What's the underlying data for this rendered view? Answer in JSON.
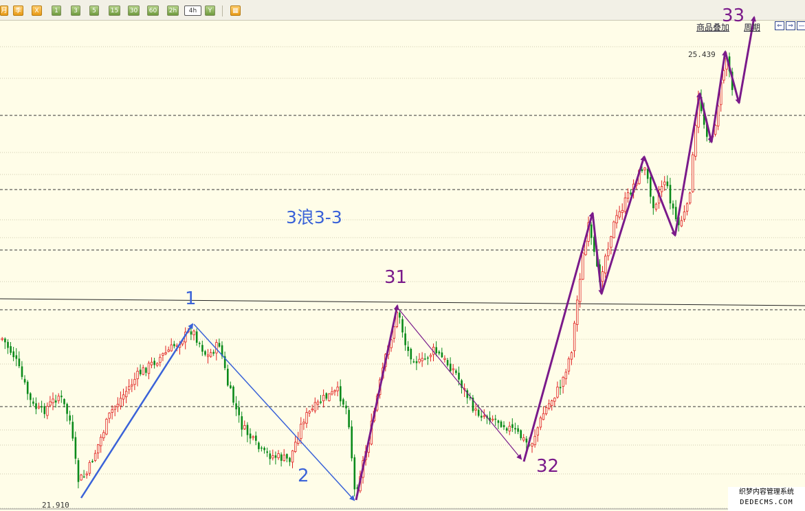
{
  "toolbar": {
    "buttons": [
      {
        "label": "月",
        "style": "orange"
      },
      {
        "label": "季",
        "style": "orange"
      },
      {
        "label": "X",
        "style": "orange"
      },
      {
        "label": "1",
        "style": "period"
      },
      {
        "label": "3",
        "style": "period"
      },
      {
        "label": "5",
        "style": "period"
      },
      {
        "label": "15",
        "style": "period"
      },
      {
        "label": "30",
        "style": "period"
      },
      {
        "label": "60",
        "style": "period"
      },
      {
        "label": "2h",
        "style": "period"
      },
      {
        "label": "4h",
        "style": "active"
      },
      {
        "label": "Y",
        "style": "period"
      }
    ],
    "grid_icon": "grid-icon"
  },
  "header_links": {
    "overlay": "商品叠加",
    "period": "周期"
  },
  "nav_buttons": [
    "left-arrow-icon",
    "right-arrow-icon",
    "minimize-icon"
  ],
  "labels": {
    "title": "3浪3-3",
    "price_high": "25.439",
    "price_low": "21.910"
  },
  "colors": {
    "background": "#fffde8",
    "candle_up": "#e02020",
    "candle_down": "#0a8a1a",
    "blue_wave": "#3a62d8",
    "purple_wave": "#7a1a8a",
    "grid": "#333333"
  },
  "watermark": {
    "line1": "织梦内容管理系统",
    "line2": "DEDECMS.COM"
  },
  "chart_data": {
    "type": "candlestick",
    "title": "3浪3-3",
    "y_range": [
      21.8,
      25.8
    ],
    "price_extremes": {
      "high": 25.439,
      "low": 21.91
    },
    "wave_labels": [
      {
        "text": "1",
        "color": "blue",
        "x": 279,
        "price": 23.08
      },
      {
        "text": "2",
        "color": "blue",
        "x": 520,
        "price": 21.88
      },
      {
        "text": "31",
        "color": "purple",
        "x": 577,
        "price": 23.15
      },
      {
        "text": "32",
        "color": "purple",
        "x": 765,
        "price": 22.29
      },
      {
        "text": "33",
        "color": "purple",
        "x": 1095,
        "price": 25.72
      }
    ],
    "reference_line": {
      "start_price": 23.15,
      "end_price": 23.05
    }
  }
}
